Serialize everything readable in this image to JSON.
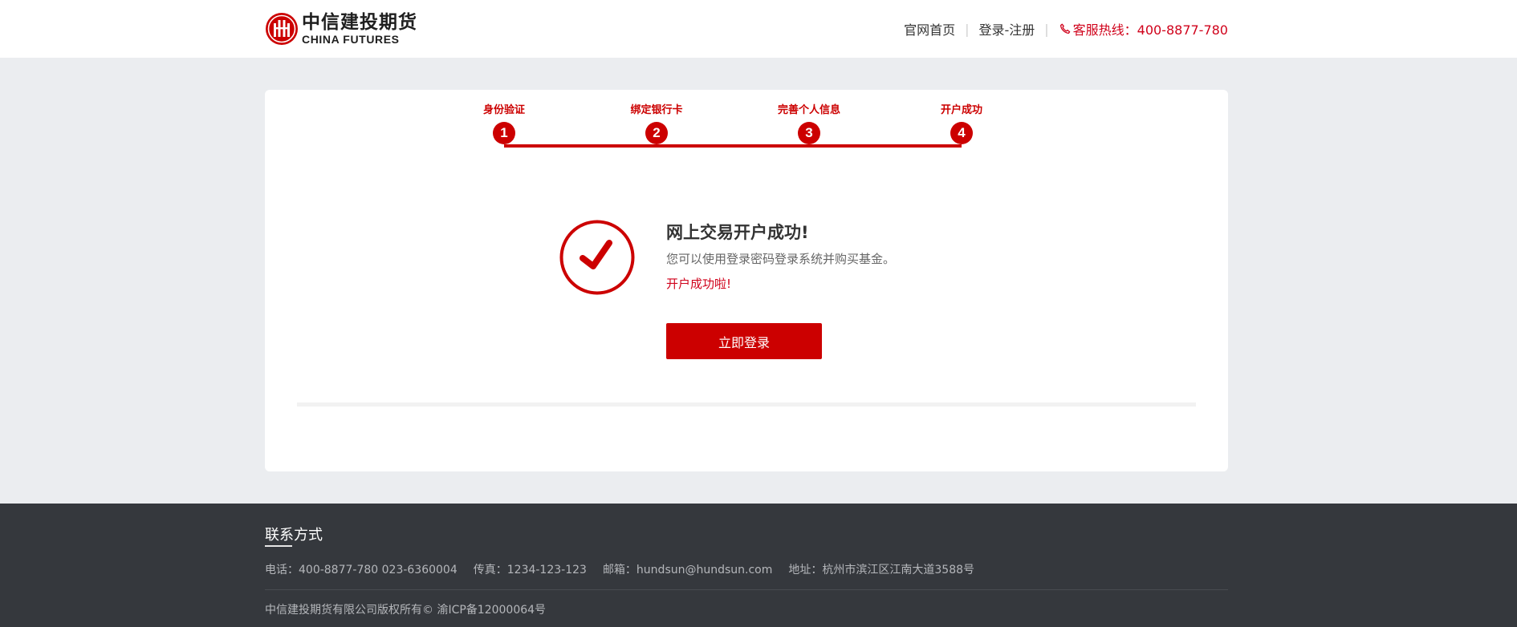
{
  "header": {
    "logo": {
      "cn": "中信建投期货",
      "en": "CHINA FUTURES",
      "icon": "citic-logo-icon"
    },
    "nav": {
      "home": "官网首页",
      "login_register": "登录-注册",
      "separator": "|",
      "hotline_icon": "phone-icon",
      "hotline": "客服热线：400-8877-780"
    }
  },
  "steps": [
    {
      "label": "身份验证",
      "number": "1"
    },
    {
      "label": "绑定银行卡",
      "number": "2"
    },
    {
      "label": "完善个人信息",
      "number": "3"
    },
    {
      "label": "开户成功",
      "number": "4"
    }
  ],
  "result": {
    "icon": "check-circle-icon",
    "title": "网上交易开户成功!",
    "description": "您可以使用登录密码登录系统并购买基金。",
    "note": "开户成功啦!",
    "button_label": "立即登录"
  },
  "footer": {
    "title": "联系方式",
    "phone": "电话：400-8877-780 023-6360004",
    "fax": "传真：1234-123-123",
    "email": "邮箱：hundsun@hundsun.com",
    "address": "地址：杭州市滨江区江南大道3588号",
    "copyright": "中信建投期货有限公司版权所有© 渝ICP备12000064号"
  },
  "colors": {
    "brand_red": "#cc0000",
    "page_bg": "#ebedf0",
    "footer_bg": "#35383d"
  }
}
